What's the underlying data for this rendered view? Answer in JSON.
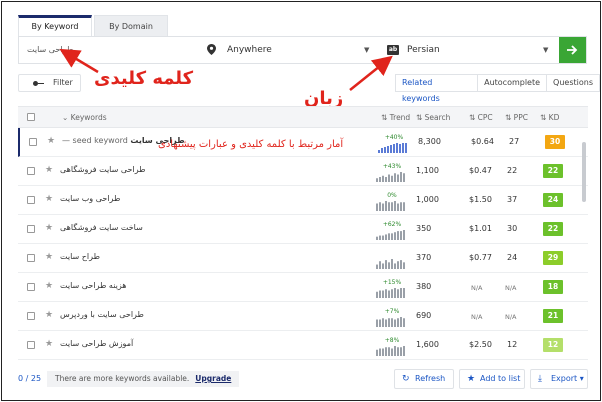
{
  "tabs": [
    {
      "label": "By Keyword",
      "active": true
    },
    {
      "label": "By Domain",
      "active": false
    }
  ],
  "search": {
    "keyword_value": "طراحی سایت",
    "location": "Anywhere",
    "language": "Persian",
    "language_icon_text": "ab"
  },
  "toolbar": {
    "filter_label": "Filter",
    "modes": [
      "Related keywords",
      "Autocomplete",
      "Questions"
    ],
    "active_mode": "Related keywords"
  },
  "annotations": {
    "keyword_note": "کلمه کلیدی",
    "language_note": "زبان",
    "stats_note": "آمار مرتبط با کلمه کلیدی و عبارات پیشنهادی"
  },
  "table": {
    "headers": {
      "keywords": "Keywords",
      "trend": "Trend",
      "search": "Search",
      "cpc": "CPC",
      "ppc": "PPC",
      "kd": "KD"
    },
    "rows": [
      {
        "keyword": "طراحی سایت",
        "seed": "seed keyword —",
        "trend_pct": "+40%",
        "trend": [
          3,
          5,
          6,
          7,
          8,
          9,
          10,
          9,
          10,
          10
        ],
        "search": "8,300",
        "cpc": "$0.64",
        "ppc": "27",
        "kd": "30",
        "kd_color": "#f3a712"
      },
      {
        "keyword": "طراحی سایت فروشگاهی",
        "seed": "",
        "trend_pct": "+43%",
        "trend": [
          3,
          4,
          5,
          4,
          6,
          5,
          7,
          6,
          8,
          7
        ],
        "search": "1,100",
        "cpc": "$0.47",
        "ppc": "22",
        "kd": "22",
        "kd_color": "#6cc12b"
      },
      {
        "keyword": "طراحی وب سایت",
        "seed": "",
        "trend_pct": "0%",
        "trend": [
          6,
          7,
          6,
          8,
          7,
          7,
          8,
          6,
          7,
          7
        ],
        "search": "1,000",
        "cpc": "$1.50",
        "ppc": "37",
        "kd": "24",
        "kd_color": "#6cc12b"
      },
      {
        "keyword": "ساخت سایت فروشگاهی",
        "seed": "",
        "trend_pct": "+62%",
        "trend": [
          3,
          4,
          4,
          5,
          6,
          6,
          7,
          8,
          8,
          9
        ],
        "search": "350",
        "cpc": "$1.01",
        "ppc": "30",
        "kd": "22",
        "kd_color": "#6cc12b"
      },
      {
        "keyword": "طراح سایت",
        "seed": "",
        "trend_pct": "",
        "trend": [
          4,
          7,
          5,
          8,
          6,
          9,
          5,
          7,
          8,
          6
        ],
        "search": "370",
        "cpc": "$0.77",
        "ppc": "24",
        "kd": "29",
        "kd_color": "#8ccd2a"
      },
      {
        "keyword": "هزینه طراحی سایت",
        "seed": "",
        "trend_pct": "+15%",
        "trend": [
          5,
          6,
          6,
          7,
          6,
          7,
          8,
          7,
          8,
          8
        ],
        "search": "380",
        "cpc": "N/A",
        "ppc": "N/A",
        "kd": "18",
        "kd_color": "#6cc12b"
      },
      {
        "keyword": "طراحی سایت با وردپرس",
        "seed": "",
        "trend_pct": "+7%",
        "trend": [
          6,
          6,
          7,
          6,
          7,
          7,
          6,
          7,
          8,
          7
        ],
        "search": "690",
        "cpc": "N/A",
        "ppc": "N/A",
        "kd": "21",
        "kd_color": "#6cc12b"
      },
      {
        "keyword": "آموزش طراحی سایت",
        "seed": "",
        "trend_pct": "+8%",
        "trend": [
          5,
          6,
          6,
          7,
          7,
          6,
          8,
          7,
          7,
          8
        ],
        "search": "1,600",
        "cpc": "$2.50",
        "ppc": "12",
        "kd": "12",
        "kd_color": "#b4df6a"
      }
    ]
  },
  "footer": {
    "count": "0 / 25",
    "notice": "There are more keywords available.",
    "upgrade": "Upgrade",
    "refresh": "Refresh",
    "add_to_list": "Add to list",
    "export": "Export"
  }
}
